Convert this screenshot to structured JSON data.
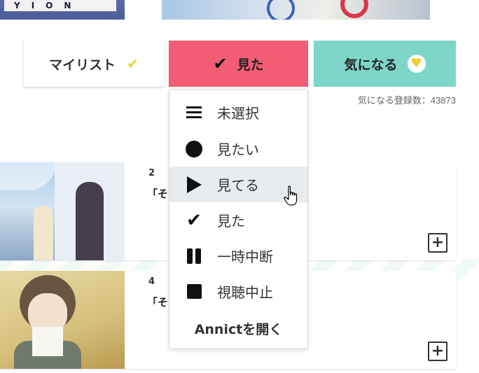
{
  "top_thumbnail_left": {
    "letters": "YION"
  },
  "status_buttons": {
    "mylist": {
      "label": "マイリスト",
      "icon": "check-icon",
      "icon_color": "#f2cf2b"
    },
    "watched": {
      "label": "見た",
      "icon": "check-icon",
      "color": "#f25d73"
    },
    "interested": {
      "label": "気になる",
      "icon": "heart-icon",
      "color": "#7dd6c8"
    }
  },
  "watchers": {
    "text": "気になる登録数：43873"
  },
  "dropdown": {
    "items": [
      {
        "label": "未選択",
        "icon": "list-icon"
      },
      {
        "label": "見たい",
        "icon": "circle-icon"
      },
      {
        "label": "見てる",
        "icon": "play-icon",
        "hovered": true
      },
      {
        "label": "見た",
        "icon": "check-icon"
      },
      {
        "label": "一時中断",
        "icon": "pause-icon"
      },
      {
        "label": "視聴中止",
        "icon": "stop-icon"
      }
    ],
    "open_annict": "Annictを開く"
  },
  "episodes": [
    {
      "number": "2",
      "title": "「その"
    },
    {
      "number": "4",
      "title": "「その"
    }
  ]
}
